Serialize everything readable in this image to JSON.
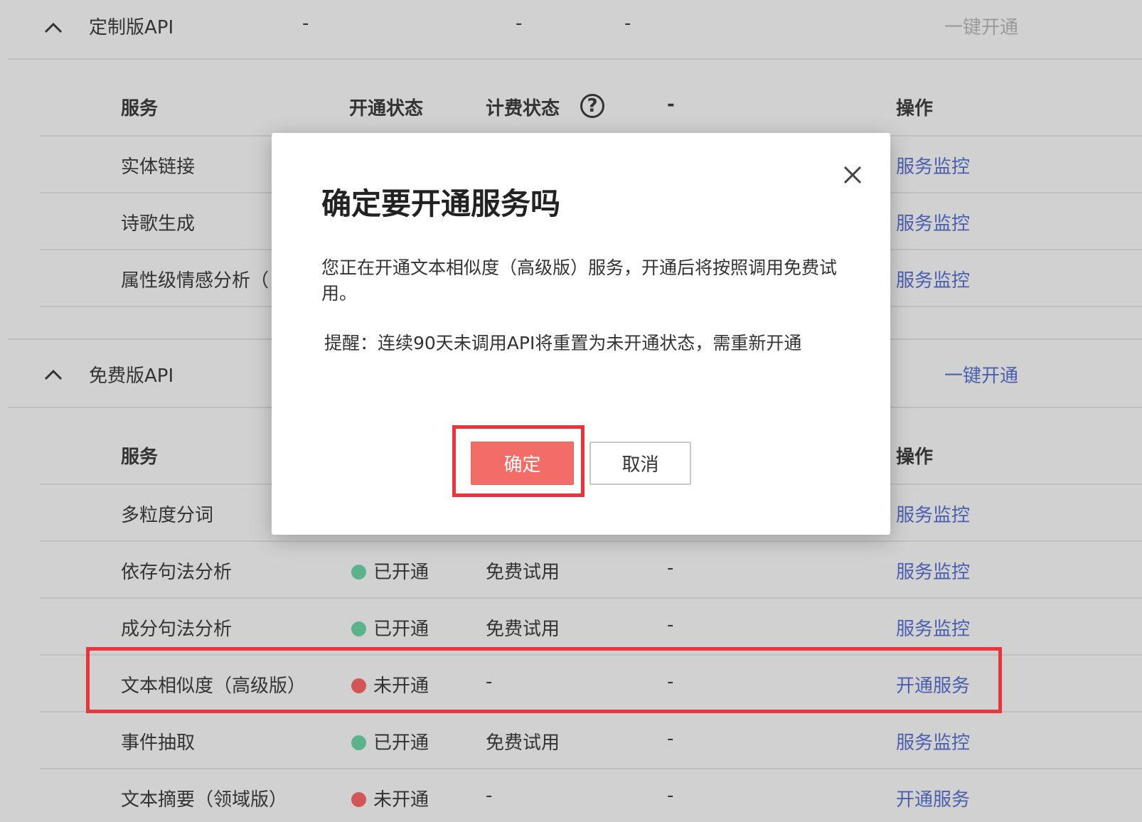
{
  "colors": {
    "background": "#d1d1d1",
    "link": "#4a5fb0",
    "disabled": "#9a9a9a",
    "enabled_dot": "#5bb38c",
    "disabled_dot": "#d35656",
    "confirm": "#f26d68",
    "highlight": "#e8343a"
  },
  "custom_section": {
    "title": "定制版API",
    "dash1": "-",
    "dash2": "-",
    "dash3": "-",
    "bulk_enable": "一键开通",
    "columns": {
      "service": "服务",
      "status": "开通状态",
      "billing": "计费状态",
      "help": "?",
      "extra": "-",
      "action": "操作"
    },
    "rows": [
      {
        "service": "实体链接",
        "action": "服务监控"
      },
      {
        "service": "诗歌生成",
        "action": "服务监控"
      },
      {
        "service": "属性级情感分析（",
        "action": "服务监控"
      }
    ]
  },
  "free_section": {
    "title": "免费版API",
    "bulk_enable": "一键开通",
    "columns": {
      "service": "服务",
      "action": "操作"
    },
    "rows": [
      {
        "service": "多粒度分词",
        "status": "",
        "billing": "",
        "extra": "",
        "action": "服务监控"
      },
      {
        "service": "依存句法分析",
        "status": "已开通",
        "status_color": "#5bb38c",
        "billing": "免费试用",
        "extra": "-",
        "action": "服务监控"
      },
      {
        "service": "成分句法分析",
        "status": "已开通",
        "status_color": "#5bb38c",
        "billing": "免费试用",
        "extra": "-",
        "action": "服务监控"
      },
      {
        "service": "文本相似度（高级版）",
        "status": "未开通",
        "status_color": "#d35656",
        "billing": "-",
        "extra": "-",
        "action": "开通服务"
      },
      {
        "service": "事件抽取",
        "status": "已开通",
        "status_color": "#5bb38c",
        "billing": "免费试用",
        "extra": "-",
        "action": "服务监控"
      },
      {
        "service": "文本摘要（领域版）",
        "status": "未开通",
        "status_color": "#d35656",
        "billing": "-",
        "extra": "-",
        "action": "开通服务"
      }
    ]
  },
  "modal": {
    "title": "确定要开通服务吗",
    "body": "您正在开通文本相似度（高级版）服务，开通后将按照调用免费试用。",
    "reminder": "提醒：连续90天未调用API将重置为未开通状态，需重新开通",
    "confirm": "确定",
    "cancel": "取消",
    "close_icon": "close-icon"
  }
}
